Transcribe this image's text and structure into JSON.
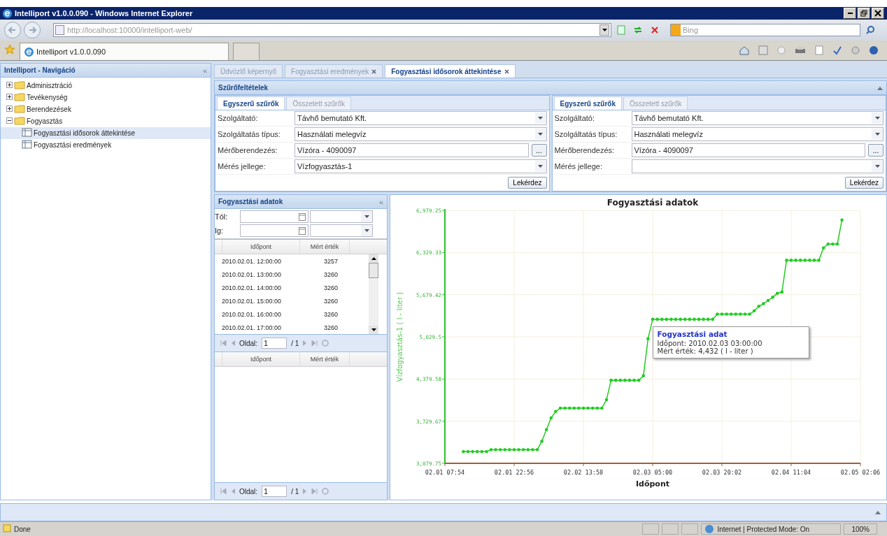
{
  "window": {
    "title": "Intelliport v1.0.0.090 - Windows Internet Explorer"
  },
  "browser": {
    "address": "http://localhost:10000/intelliport-web/",
    "search_placeholder": "Bing",
    "tabs": [
      {
        "label": "Intelliport v1.0.0.090",
        "selected": true
      },
      {
        "selected": false
      }
    ]
  },
  "navigation": {
    "title": "Intelliport - Navigáció",
    "collapse_glyph": "«",
    "tree": [
      {
        "label": "Adminisztráció",
        "expanded": false,
        "selected": false
      },
      {
        "label": "Tevékenység",
        "expanded": false,
        "selected": false
      },
      {
        "label": "Berendezések",
        "expanded": false,
        "selected": false
      },
      {
        "label": "Fogyasztás",
        "expanded": true,
        "selected": false,
        "children": [
          {
            "label": "Fogyasztási idősorok áttekintése",
            "selected": true
          },
          {
            "label": "Fogyasztási eredmények",
            "selected": false
          }
        ]
      }
    ]
  },
  "content_tabs": [
    {
      "label": "Üdvözlő képernyő",
      "selected": false,
      "closable": false
    },
    {
      "label": "Fogyasztási eredmények",
      "selected": false,
      "closable": true
    },
    {
      "label": "Fogyasztási idősorok áttekintése",
      "selected": true,
      "closable": true
    }
  ],
  "filter_panel": {
    "title": "Szűrőfeltételek",
    "forms": [
      {
        "tabs": [
          {
            "label": "Egyszerű szűrők",
            "selected": true
          },
          {
            "label": "Összetett szűrők",
            "selected": false
          }
        ],
        "fields": [
          {
            "label": "Szolgáltató:",
            "value": "Távhő bemutató Kft.",
            "kind": "combo"
          },
          {
            "label": "Szolgáltatás típus:",
            "value": "Használati melegvíz",
            "kind": "combo"
          },
          {
            "label": "Mérőberendezés:",
            "value": "Vízóra - 4090097",
            "kind": "picker",
            "button": "..."
          },
          {
            "label": "Mérés jellege:",
            "value": "Vízfogyasztás-1",
            "kind": "combo"
          }
        ],
        "submit": "Lekérdez"
      },
      {
        "tabs": [
          {
            "label": "Egyszerű szűrők",
            "selected": true
          },
          {
            "label": "Összetett szűrők",
            "selected": false
          }
        ],
        "fields": [
          {
            "label": "Szolgáltató:",
            "value": "Távhő bemutató Kft.",
            "kind": "combo"
          },
          {
            "label": "Szolgáltatás típus:",
            "value": "Használati melegvíz",
            "kind": "combo"
          },
          {
            "label": "Mérőberendezés:",
            "value": "Vízóra - 4090097",
            "kind": "picker",
            "button": "..."
          },
          {
            "label": "Mérés jellege:",
            "kind": "combo"
          }
        ],
        "submit": "Lekérdez"
      }
    ]
  },
  "data_panel": {
    "title": "Fogyasztási adatok",
    "collapse_glyph": "«",
    "range": [
      {
        "label": "Tól:"
      },
      {
        "label": "Ig:"
      }
    ],
    "grids": [
      {
        "columns": [
          "Időpont",
          "Mért érték"
        ],
        "rows": [
          [
            "2010.02.01. 12:00:00",
            "3257"
          ],
          [
            "2010.02.01. 13:00:00",
            "3260"
          ],
          [
            "2010.02.01. 14:00:00",
            "3260"
          ],
          [
            "2010.02.01. 15:00:00",
            "3260"
          ],
          [
            "2010.02.01. 16:00:00",
            "3260"
          ],
          [
            "2010.02.01. 17:00:00",
            "3260"
          ]
        ],
        "pager": {
          "label": "Oldal:",
          "page": "1",
          "total": "/ 1"
        }
      },
      {
        "columns": [
          "Időpont",
          "Mért érték"
        ],
        "pager": {
          "label": "Oldal:",
          "page": "1",
          "total": "/ 1"
        }
      }
    ]
  },
  "chart_panel": {
    "chart_data": {
      "type": "line",
      "title": "Fogyasztási adatok",
      "xlabel": "Időpont",
      "ylabel": "Vízfogyasztás-1 ( l - liter )",
      "ylim": [
        3079.75,
        6979.25
      ],
      "grid": true,
      "categories": [
        "02.01 07:54",
        null,
        null,
        null,
        null,
        null,
        null,
        null,
        null,
        null,
        null,
        null,
        null,
        null,
        null,
        "02.01 22:56",
        null,
        null,
        null,
        null,
        null,
        null,
        null,
        null,
        null,
        null,
        null,
        null,
        null,
        null,
        "02.02 13:58",
        null,
        null,
        null,
        null,
        null,
        null,
        null,
        null,
        null,
        null,
        null,
        null,
        null,
        null,
        "02.03 05:00",
        null,
        null,
        null,
        null,
        null,
        null,
        null,
        null,
        null,
        null,
        null,
        null,
        null,
        null,
        "02.03 20:02",
        null,
        null,
        null,
        null,
        null,
        null,
        null,
        null,
        null,
        null,
        null,
        null,
        null,
        null,
        "02.04 11:04",
        null,
        null,
        null,
        null,
        null,
        null,
        null,
        null,
        null,
        null,
        null,
        null,
        null,
        null,
        "02.05 02:06"
      ],
      "yticks": [
        {
          "value": 3079.75,
          "label": "3,079.75"
        },
        {
          "value": 3729.67,
          "label": "3,729.67"
        },
        {
          "value": 4379.58,
          "label": "4,379.58"
        },
        {
          "value": 5029.5,
          "label": "5,029.5"
        },
        {
          "value": 5679.42,
          "label": "5,679.42"
        },
        {
          "value": 6329.33,
          "label": "6,329.33"
        },
        {
          "value": 6979.25,
          "label": "6,979.25"
        }
      ],
      "series": [
        {
          "color": "#22cc22",
          "values": [
            null,
            null,
            null,
            null,
            3260,
            3260,
            3260,
            3260,
            3260,
            3260,
            3290,
            3290,
            3290,
            3290,
            3290,
            3290,
            3290,
            3290,
            3290,
            3290,
            3290,
            3420,
            3600,
            3780,
            3880,
            3930,
            3930,
            3930,
            3930,
            3930,
            3930,
            3930,
            3930,
            3930,
            3930,
            4060,
            4360,
            4360,
            4360,
            4360,
            4360,
            4360,
            4360,
            4430,
            5000,
            5300,
            5300,
            5300,
            5300,
            5300,
            5300,
            5300,
            5300,
            5300,
            5300,
            5300,
            5300,
            5300,
            5300,
            5380,
            5380,
            5380,
            5380,
            5380,
            5380,
            5380,
            5380,
            5430,
            5500,
            5540,
            5590,
            5640,
            5700,
            5720,
            6210,
            6210,
            6210,
            6210,
            6210,
            6210,
            6210,
            6210,
            6400,
            6460,
            6460,
            6460,
            6830,
            null,
            null,
            null,
            null
          ]
        }
      ]
    },
    "tooltip": {
      "title": "Fogyasztási adat",
      "lines": [
        "Időpont: 2010.02.03 03:00:00",
        "Mért érték: 4,432 ( l - liter )"
      ]
    }
  },
  "status_bar": {
    "text": "Done",
    "zone": "Internet | Protected Mode: On",
    "zoom": "100%"
  }
}
